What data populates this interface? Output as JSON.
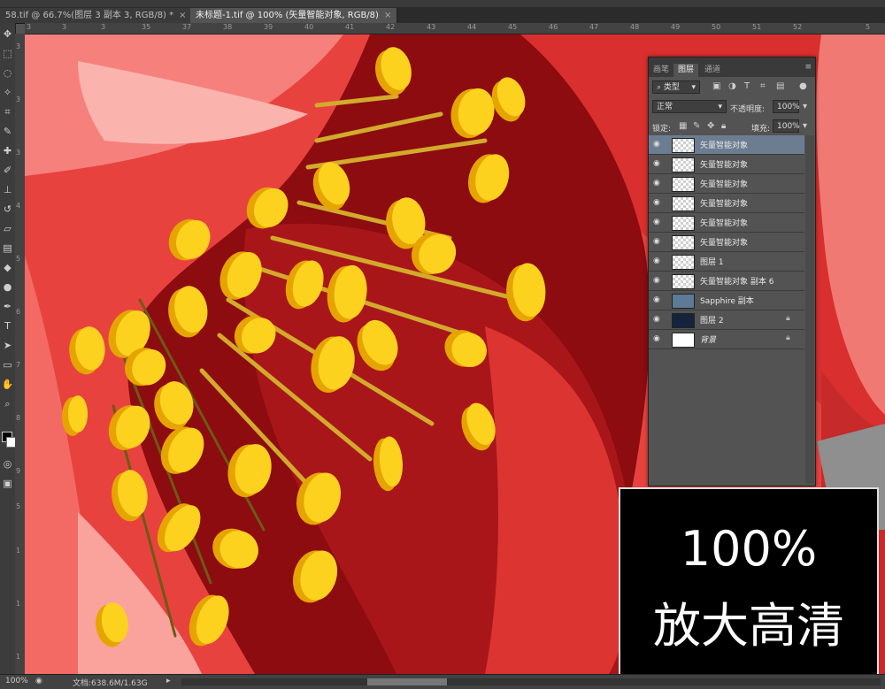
{
  "tabs": [
    {
      "label": "58.tif @ 66.7%(图层 3 副本 3, RGB/8) *",
      "close": "×",
      "active": false
    },
    {
      "label": "未标题-1.tif @ 100% (矢量智能对象, RGB/8)",
      "close": "×",
      "active": true
    }
  ],
  "ruler_top": [
    "3",
    "3",
    "3",
    "35",
    "37",
    "38",
    "39",
    "40",
    "41",
    "42",
    "43",
    "44",
    "45",
    "46",
    "47",
    "48",
    "49",
    "50",
    "51",
    "52",
    "5"
  ],
  "ruler_left": [
    "3",
    "3",
    "3",
    "4",
    "5",
    "6",
    "7",
    "8",
    "9",
    "5",
    "1",
    "1",
    "1"
  ],
  "tools": [
    "move-tool",
    "marquee-tool",
    "lasso-tool",
    "magic-wand-tool",
    "crop-tool",
    "eyedropper-tool",
    "healing-tool",
    "brush-tool",
    "stamp-tool",
    "history-brush-tool",
    "eraser-tool",
    "gradient-tool",
    "blur-tool",
    "dodge-tool",
    "pen-tool",
    "type-tool",
    "path-select-tool",
    "shape-tool",
    "hand-tool",
    "zoom-tool"
  ],
  "panel": {
    "tabs": [
      "画笔",
      "图层",
      "通道"
    ],
    "active_tab": "图层",
    "filter_label": "类型",
    "blend_mode": "正常",
    "opacity_label": "不透明度:",
    "opacity_value": "100%",
    "lock_label": "锁定:",
    "fill_label": "填充:",
    "fill_value": "100%"
  },
  "layers": [
    {
      "name": "矢量智能对象",
      "selected": true,
      "locked": false,
      "thumb": "checker"
    },
    {
      "name": "矢量智能对象",
      "selected": false,
      "locked": false,
      "thumb": "checker"
    },
    {
      "name": "矢量智能对象",
      "selected": false,
      "locked": false,
      "thumb": "checker"
    },
    {
      "name": "矢量智能对象",
      "selected": false,
      "locked": false,
      "thumb": "checker"
    },
    {
      "name": "矢量智能对象",
      "selected": false,
      "locked": false,
      "thumb": "checker"
    },
    {
      "name": "矢量智能对象",
      "selected": false,
      "locked": false,
      "thumb": "checker"
    },
    {
      "name": "图层 1",
      "selected": false,
      "locked": false,
      "thumb": "checker"
    },
    {
      "name": "矢量智能对象 副本 6",
      "selected": false,
      "locked": false,
      "thumb": "checker"
    },
    {
      "name": "Sapphire 副本",
      "selected": false,
      "locked": false,
      "thumb": "#5d7a96"
    },
    {
      "name": "图层 2",
      "selected": false,
      "locked": true,
      "thumb": "#15233d"
    },
    {
      "name": "背景",
      "selected": false,
      "locked": true,
      "thumb": "#ffffff",
      "italic": true
    }
  ],
  "overlay": {
    "line1": "100%",
    "line2": "放大高清"
  },
  "status": {
    "zoom": "100%",
    "doc": "文档:638.6M/1.63G"
  },
  "colors": {
    "petal_main": "#e8423f",
    "petal_dark": "#8c0c10",
    "petal_light": "#f6807b",
    "anther": "#fdd21f",
    "anther_shadow": "#e6a400",
    "filament": "#d3aa2c",
    "selected_layer": "#6c7d91"
  }
}
